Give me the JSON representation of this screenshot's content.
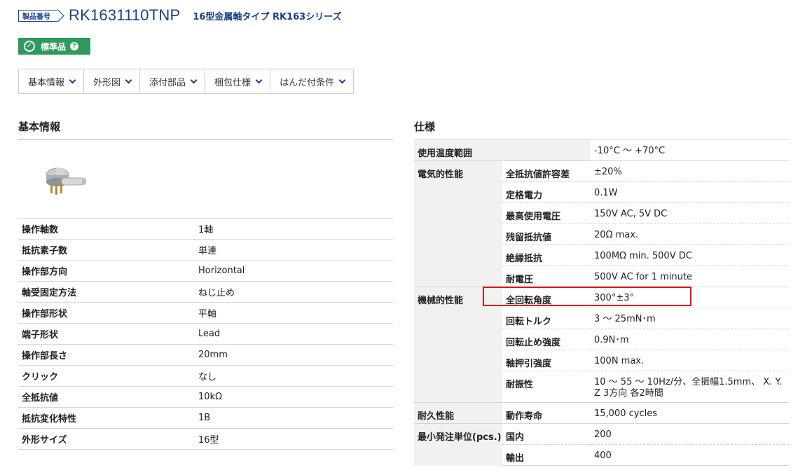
{
  "header": {
    "tag_label": "製品番号",
    "part_number": "RK1631110TNP",
    "series": "16型金属軸タイプ RK163シリーズ"
  },
  "badge": {
    "label": "標準品",
    "help": "?"
  },
  "tabs": [
    {
      "label": "基本情報"
    },
    {
      "label": "外形図"
    },
    {
      "label": "添付部品"
    },
    {
      "label": "梱包仕様"
    },
    {
      "label": "はんだ付条件"
    }
  ],
  "basic": {
    "title": "基本情報",
    "rows": [
      {
        "k": "操作軸数",
        "v": "1軸"
      },
      {
        "k": "抵抗素子数",
        "v": "単連"
      },
      {
        "k": "操作部方向",
        "v": "Horizontal"
      },
      {
        "k": "軸受固定方法",
        "v": "ねじ止め"
      },
      {
        "k": "操作部形状",
        "v": "平軸"
      },
      {
        "k": "端子形状",
        "v": "Lead"
      },
      {
        "k": "操作部長さ",
        "v": "20mm"
      },
      {
        "k": "クリック",
        "v": "なし"
      },
      {
        "k": "全抵抗値",
        "v": "10kΩ"
      },
      {
        "k": "抵抗変化特性",
        "v": "1B"
      },
      {
        "k": "外形サイズ",
        "v": "16型"
      }
    ]
  },
  "spec": {
    "title": "仕様",
    "rows": [
      {
        "g": "使用温度範囲",
        "s": "",
        "v": "-10°C 〜 +70°C"
      },
      {
        "g": "電気的性能",
        "s": "全抵抗値許容差",
        "v": "±20%"
      },
      {
        "g": "",
        "s": "定格電力",
        "v": "0.1W"
      },
      {
        "g": "",
        "s": "最高使用電圧",
        "v": "150V AC, 5V DC"
      },
      {
        "g": "",
        "s": "残留抵抗値",
        "v": "20Ω max."
      },
      {
        "g": "",
        "s": "絶縁抵抗",
        "v": "100MΩ min. 500V DC"
      },
      {
        "g": "",
        "s": "耐電圧",
        "v": "500V AC for 1 minute"
      },
      {
        "g": "機械的性能",
        "s": "全回転角度",
        "v": "300°±3°"
      },
      {
        "g": "",
        "s": "回転トルク",
        "v": "3 〜 25mN･m"
      },
      {
        "g": "",
        "s": "回転止め強度",
        "v": "0.9N･m"
      },
      {
        "g": "",
        "s": "軸押引強度",
        "v": "100N max."
      },
      {
        "g": "",
        "s": "耐振性",
        "v": "10 〜 55 〜 10Hz/分、全振幅1.5mm、 X. Y. Z 3方向 各2時間"
      },
      {
        "g": "耐久性能",
        "s": "動作寿命",
        "v": "15,000 cycles"
      },
      {
        "g": "最小発注単位(pcs.)",
        "s": "国内",
        "v": "200"
      },
      {
        "g": "",
        "s": "輸出",
        "v": "400"
      }
    ]
  },
  "colors": {
    "brand": "#1a3f8f",
    "standard_badge": "#2e9a5e",
    "highlight": "#e01010"
  }
}
